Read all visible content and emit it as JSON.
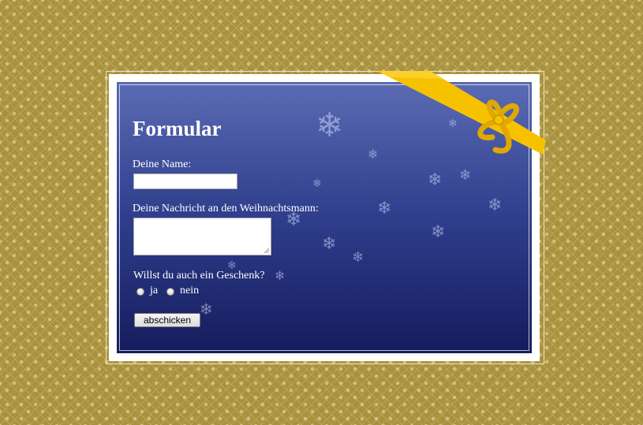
{
  "form": {
    "title": "Formular",
    "name_label": "Deine Name:",
    "message_label": "Deine Nachricht an den Weihnachtsmann:",
    "gift_question": "Willst du auch ein Geschenk?",
    "option_yes": "ja",
    "option_no": "nein",
    "submit_label": "abschicken"
  },
  "colors": {
    "background": "#a8923f",
    "panel_top": "#5b6bb3",
    "panel_bottom": "#151c5c",
    "ribbon": "#f6c200"
  },
  "icons": {
    "decoration": "snowflake-icon",
    "ribbon": "ribbon-bow-icon"
  }
}
